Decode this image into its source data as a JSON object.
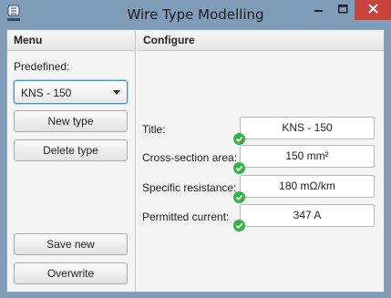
{
  "window": {
    "title": "Wire Type Modelling",
    "icon_name": "app-logo-icon",
    "controls": {
      "minimize_icon": "minimize-icon",
      "maximize_icon": "maximize-icon",
      "close_icon": "close-icon"
    }
  },
  "menu": {
    "header": "Menu",
    "predefined_label": "Predefined:",
    "predefined_selected": "KNS - 150",
    "new_type_label": "New type",
    "delete_type_label": "Delete type",
    "save_new_label": "Save new",
    "overwrite_label": "Overwrite"
  },
  "configure": {
    "header": "Configure",
    "fields": [
      {
        "label": "Title:",
        "value": "KNS - 150",
        "valid": true
      },
      {
        "label": "Cross-section area:",
        "value": "150 mm²",
        "valid": true
      },
      {
        "label": "Specific resistance:",
        "value": "180 mΩ/km",
        "valid": true
      },
      {
        "label": "Permitted current:",
        "value": "347 A",
        "valid": true
      }
    ]
  },
  "colors": {
    "titlebar": "#7f9db9",
    "close_button": "#c8443a",
    "focus_border": "#3b95d8",
    "valid_check": "#2fb344"
  }
}
